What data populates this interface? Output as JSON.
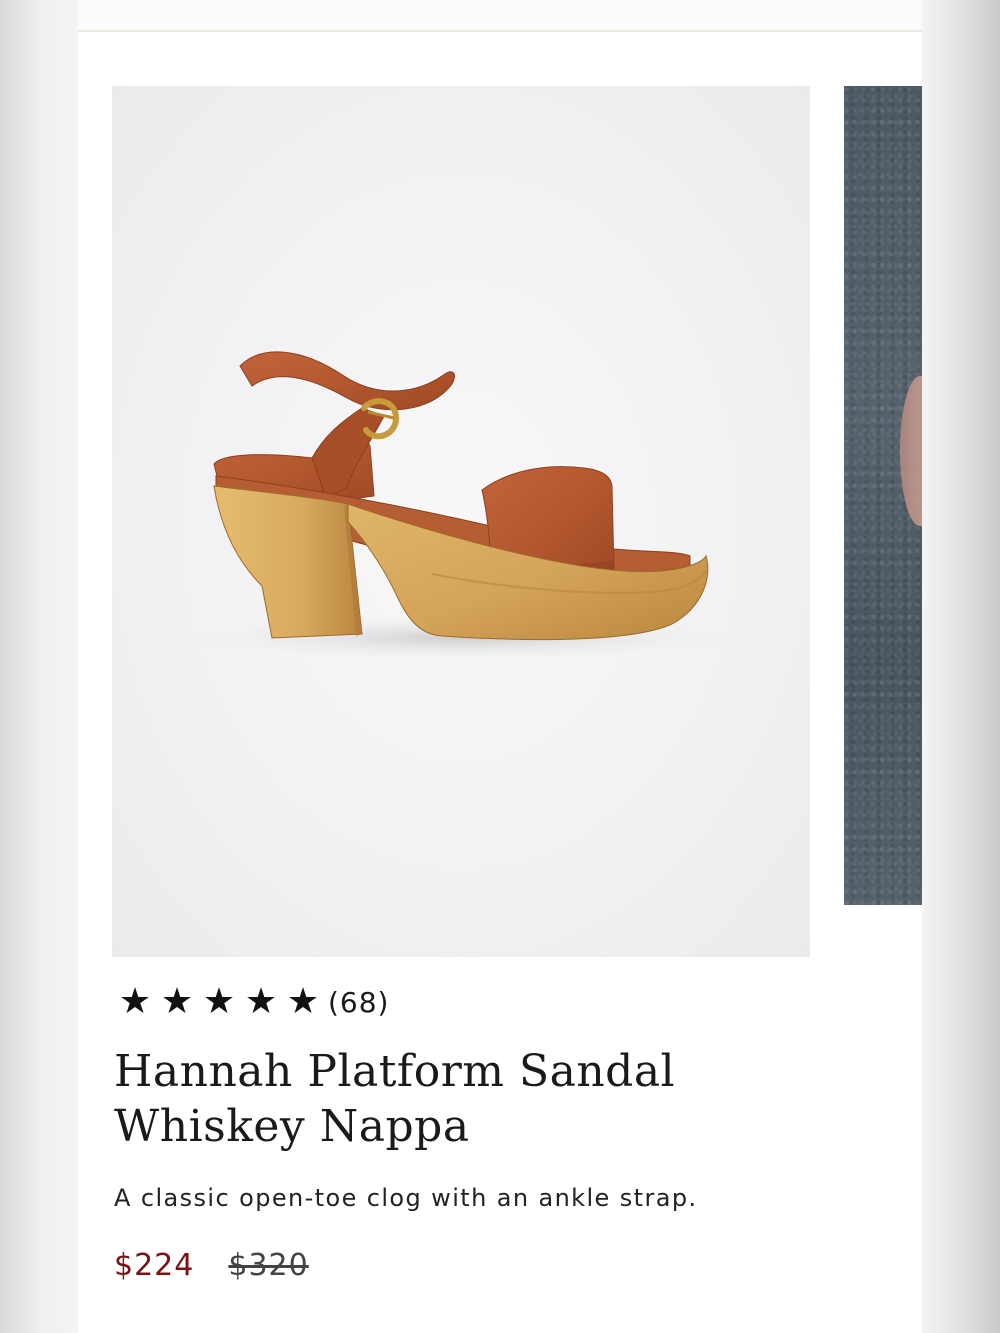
{
  "product": {
    "image_alt": "Hannah Platform Sandal in Whiskey Nappa leather with wooden clog base",
    "rating_stars": 5,
    "review_count": "(68)",
    "title_line1": "Hannah Platform Sandal",
    "title_line2": "Whiskey Nappa",
    "description": "A classic open-toe clog with an ankle strap.",
    "sale_price": "$224",
    "original_price": "$320"
  },
  "colors": {
    "sale_price": "#7a1414",
    "leather": "#b4582f",
    "wood": "#d6a85a"
  },
  "icons": {
    "star": "star-icon"
  }
}
